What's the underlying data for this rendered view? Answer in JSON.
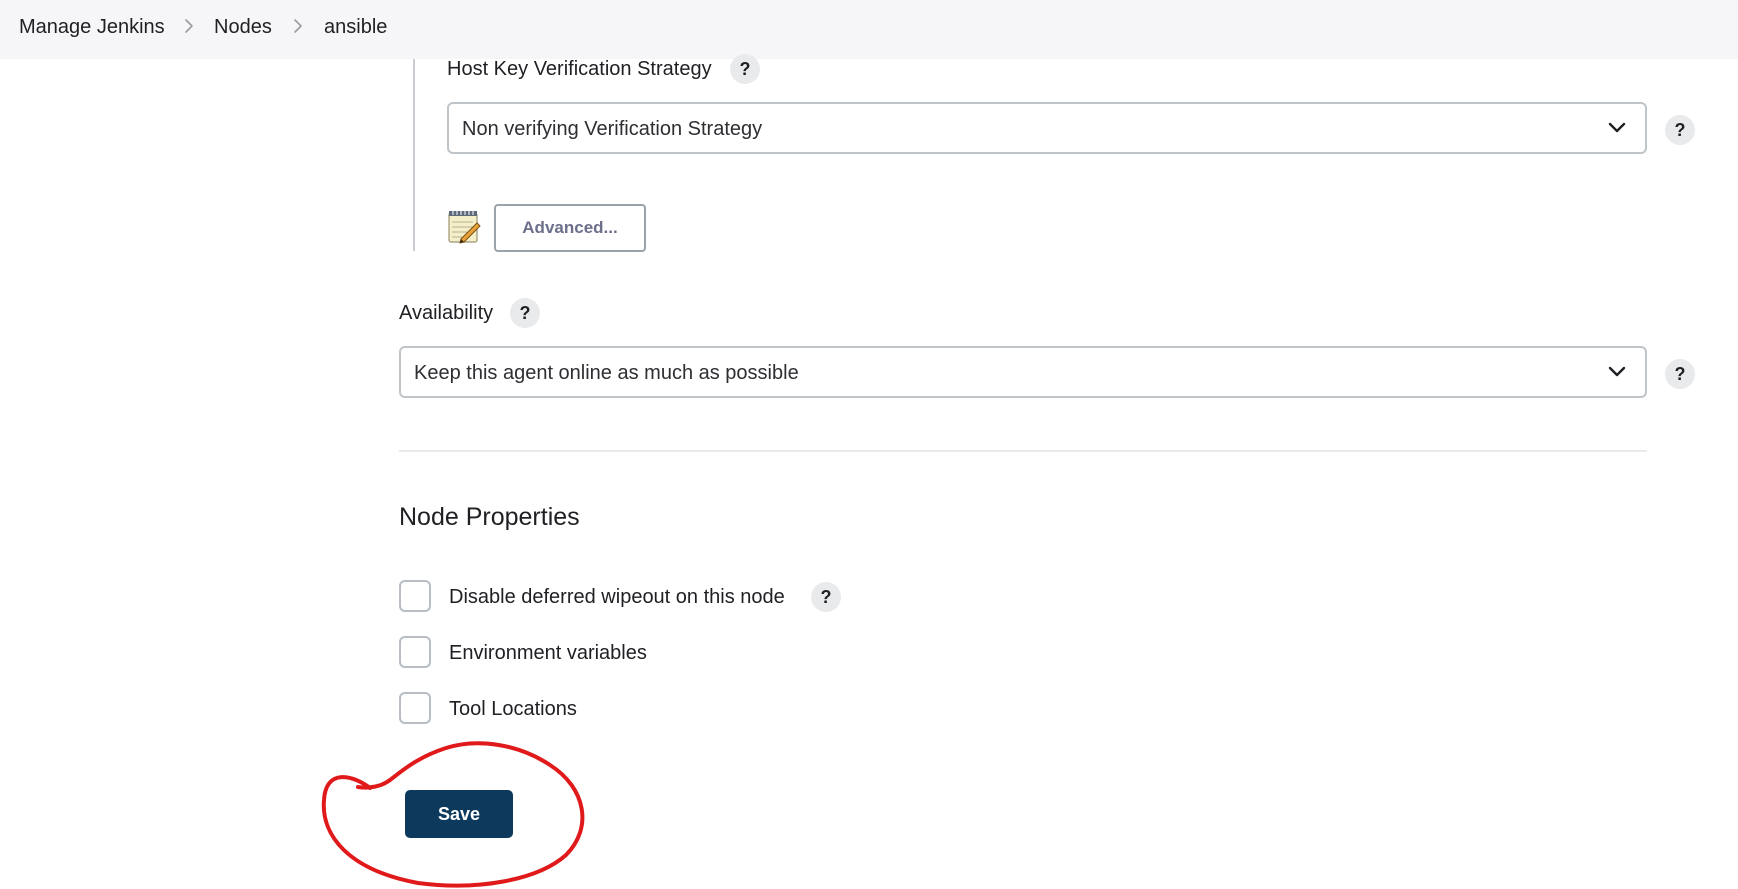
{
  "breadcrumb": {
    "items": [
      "Manage Jenkins",
      "Nodes",
      "ansible"
    ]
  },
  "host_key": {
    "label": "Host Key Verification Strategy",
    "help_label": "?",
    "selected_value": "Non verifying Verification Strategy",
    "advanced_label": "Advanced..."
  },
  "availability": {
    "label": "Availability",
    "help_label": "?",
    "selected_value": "Keep this agent online as much as possible"
  },
  "node_properties": {
    "title": "Node Properties",
    "items": [
      {
        "label": "Disable deferred wipeout on this node",
        "checked": false
      },
      {
        "label": "Environment variables",
        "checked": false
      },
      {
        "label": "Tool Locations",
        "checked": false
      }
    ],
    "help_label": "?"
  },
  "actions": {
    "save_label": "Save"
  },
  "colors": {
    "save_button": "#0d3a5c",
    "annotation_circle": "#e0191b",
    "topbar": "#f6f6f8"
  },
  "icons": [
    "chevron-right-icon",
    "chevron-down-icon",
    "notepad-icon"
  ]
}
